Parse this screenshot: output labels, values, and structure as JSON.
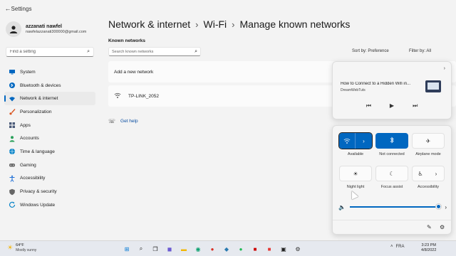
{
  "window": {
    "app_title": "Settings"
  },
  "profile": {
    "name": "azzanati nawfel",
    "email": "nawfelazzanati300000@gmail.com"
  },
  "sidebar": {
    "search_placeholder": "Find a setting",
    "items": [
      {
        "label": "System",
        "icon": "monitor-icon",
        "color": "#0067c0"
      },
      {
        "label": "Bluetooth & devices",
        "icon": "bluetooth-icon",
        "color": "#0067c0"
      },
      {
        "label": "Network & internet",
        "icon": "wifi-icon",
        "color": "#0067c0",
        "active": true
      },
      {
        "label": "Personalization",
        "icon": "brush-icon",
        "color": "#d9531e"
      },
      {
        "label": "Apps",
        "icon": "apps-icon",
        "color": "#4a5a78"
      },
      {
        "label": "Accounts",
        "icon": "person-icon",
        "color": "#2aa05a"
      },
      {
        "label": "Time & language",
        "icon": "globe-icon",
        "color": "#0a84c8"
      },
      {
        "label": "Gaming",
        "icon": "gamepad-icon",
        "color": "#666666"
      },
      {
        "label": "Accessibility",
        "icon": "accessibility-icon",
        "color": "#1f6fd6"
      },
      {
        "label": "Privacy & security",
        "icon": "shield-icon",
        "color": "#666666"
      },
      {
        "label": "Windows Update",
        "icon": "update-icon",
        "color": "#0a84c8"
      }
    ]
  },
  "main": {
    "breadcrumb": [
      "Network & internet",
      "Wi-Fi",
      "Manage known networks"
    ],
    "known_label": "Known networks",
    "search_placeholder": "Search known networks",
    "sort_label": "Sort by:",
    "sort_value": "Preference",
    "filter_label": "Filter by:",
    "filter_value": "All",
    "add_network_label": "Add a new network",
    "networks": [
      "TP-LINK_2052"
    ],
    "get_help": "Get help"
  },
  "media": {
    "title": "How to Connect to a Hidden Wifi in...",
    "channel": "DreamWebTuts"
  },
  "quick_settings": {
    "tiles": [
      {
        "label": "Available",
        "icon": "wifi-icon",
        "state": "on"
      },
      {
        "label": "Not connected",
        "icon": "bluetooth-icon",
        "state": "on"
      },
      {
        "label": "Airplane mode",
        "icon": "airplane-icon",
        "state": "off"
      },
      {
        "label": "Night light",
        "icon": "brightness-icon",
        "state": "off"
      },
      {
        "label": "Focus assist",
        "icon": "moon-icon",
        "state": "off"
      },
      {
        "label": "Accessibility",
        "icon": "accessibility-icon",
        "state": "off"
      }
    ],
    "volume_level": 1.0,
    "accent": "#0067c0"
  },
  "taskbar": {
    "weather_temp": "64°F",
    "weather_desc": "Mostly sunny",
    "language": "FRA",
    "time": "3:23 PM",
    "date": "4/8/2022"
  }
}
